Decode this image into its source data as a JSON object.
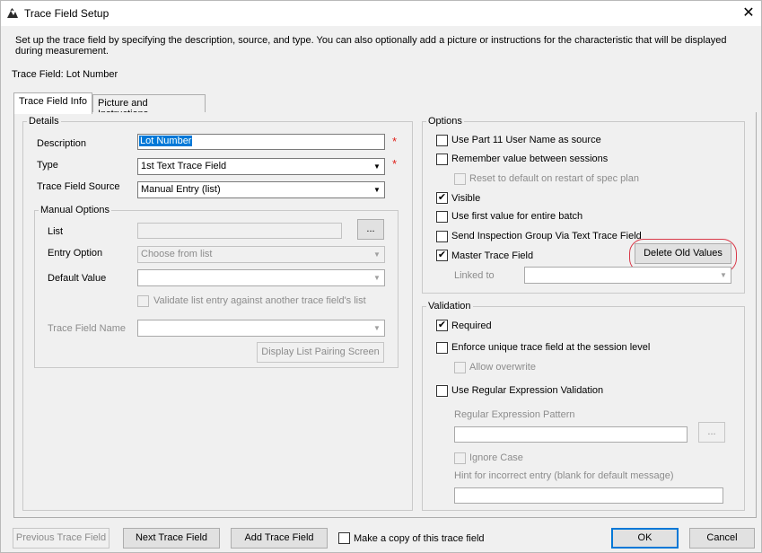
{
  "window": {
    "title": "Trace Field Setup",
    "close_icon": "close-icon"
  },
  "intro_text": "Set up the trace field by specifying the description, source, and type.  You can also optionally add a picture or instructions for the characteristic that will be displayed during measurement.",
  "trace_field_line": "Trace Field: Lot Number",
  "tabs": [
    {
      "label": "Trace Field Info",
      "active": true
    },
    {
      "label": "Picture and Instructions",
      "active": false
    }
  ],
  "details": {
    "legend": "Details",
    "description_label": "Description",
    "description_value": "Lot Number",
    "type_label": "Type",
    "type_value": "1st Text Trace Field",
    "source_label": "Trace Field Source",
    "source_value": "Manual Entry (list)",
    "required_mark": "*"
  },
  "manual_options": {
    "legend": "Manual Options",
    "list_label": "List",
    "list_button": "...",
    "entry_option_label": "Entry Option",
    "entry_option_value": "Choose from list",
    "default_value_label": "Default Value",
    "validate_label": "Validate list entry against another trace field's list",
    "trace_field_name_label": "Trace Field Name",
    "display_pairing_button": "Display List Pairing Screen"
  },
  "options": {
    "legend": "Options",
    "items": {
      "part11": {
        "label": "Use Part 11 User Name as source",
        "checked": false
      },
      "remember": {
        "label": "Remember value between sessions",
        "checked": false
      },
      "reset": {
        "label": "Reset to default on restart of spec plan",
        "checked": false
      },
      "visible": {
        "label": "Visible",
        "checked": true
      },
      "first_value": {
        "label": "Use first value for entire batch",
        "checked": false
      },
      "send_group": {
        "label": "Send Inspection Group Via Text Trace Field",
        "checked": false
      },
      "master": {
        "label": "Master Trace Field",
        "checked": true
      }
    },
    "delete_button": "Delete Old Values",
    "linked_to_label": "Linked to"
  },
  "validation": {
    "legend": "Validation",
    "required": {
      "label": "Required",
      "checked": true
    },
    "unique": {
      "label": "Enforce unique trace field at the session level",
      "checked": false
    },
    "overwrite": {
      "label": "Allow overwrite",
      "checked": false
    },
    "regex": {
      "label": "Use Regular Expression Validation",
      "checked": false
    },
    "pattern_label": "Regular Expression Pattern",
    "pattern_button": "...",
    "ignore_case": {
      "label": "Ignore Case",
      "checked": false
    },
    "hint_label": "Hint for incorrect entry (blank for default message)"
  },
  "footer": {
    "previous_button": "Previous Trace Field",
    "next_button": "Next Trace Field",
    "add_button": "Add Trace Field",
    "copy_checkbox": {
      "label": "Make a copy of this trace field",
      "checked": false
    },
    "ok_button": "OK",
    "cancel_button": "Cancel"
  },
  "colors": {
    "accent": "#0078d7",
    "required": "#e0201a",
    "highlight_circle": "#d93a4a"
  }
}
